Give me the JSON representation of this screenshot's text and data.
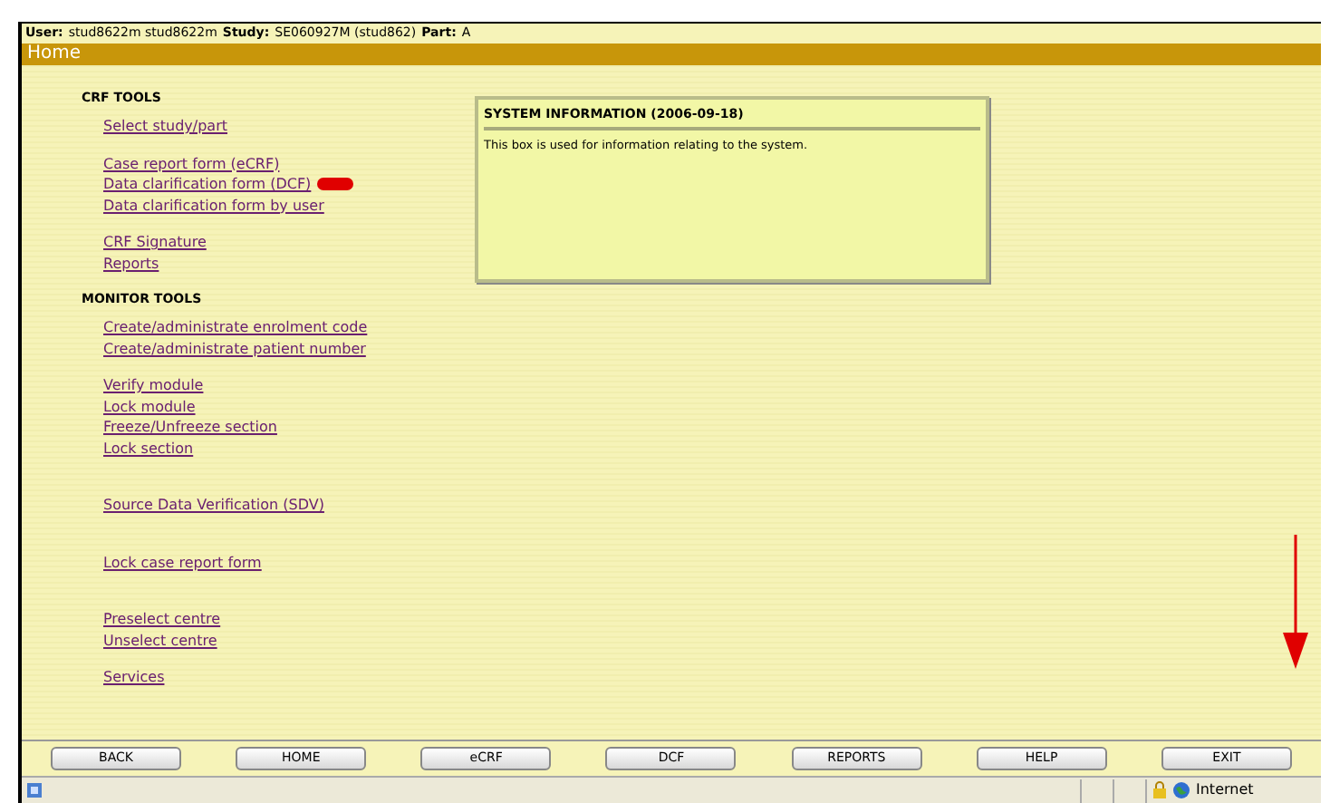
{
  "header": {
    "user_label": "User:",
    "user": "stud8622m stud8622m",
    "study_label": "Study:",
    "study": "SE060927M (stud862)",
    "part_label": "Part:",
    "part": "A"
  },
  "page_title": "Home",
  "sections": [
    {
      "title": "CRF TOOLS",
      "groups": [
        [
          {
            "label": "Select study/part",
            "badge": false
          }
        ],
        [
          {
            "label": "Case report form (eCRF)",
            "badge": false
          },
          {
            "label": "Data clarification form (DCF)",
            "badge": true
          },
          {
            "label": "Data clarification form by user",
            "badge": false
          }
        ],
        [
          {
            "label": "CRF Signature",
            "badge": false
          },
          {
            "label": "Reports",
            "badge": false
          }
        ]
      ]
    },
    {
      "title": "MONITOR TOOLS",
      "groups": [
        [
          {
            "label": "Create/administrate enrolment code",
            "badge": false
          },
          {
            "label": "Create/administrate patient number",
            "badge": false
          }
        ],
        [
          {
            "label": "Verify module",
            "badge": false
          },
          {
            "label": "Lock module",
            "badge": false
          },
          {
            "label": "Freeze/Unfreeze section",
            "badge": false
          },
          {
            "label": "Lock section",
            "badge": false
          }
        ],
        [
          {
            "label": "Source Data Verification (SDV)",
            "badge": false
          }
        ],
        [
          {
            "label": "Lock case report form",
            "badge": false
          }
        ],
        [
          {
            "label": "Preselect centre",
            "badge": false
          },
          {
            "label": "Unselect centre",
            "badge": false
          }
        ],
        [
          {
            "label": "Services",
            "badge": false
          }
        ]
      ]
    }
  ],
  "info_box": {
    "title": "SYSTEM INFORMATION (2006-09-18)",
    "text": "This box is used for information relating to the system."
  },
  "buttons": [
    "BACK",
    "HOME",
    "eCRF",
    "DCF",
    "REPORTS",
    "HELP",
    "EXIT"
  ],
  "status_bar": {
    "zone": "Internet"
  }
}
